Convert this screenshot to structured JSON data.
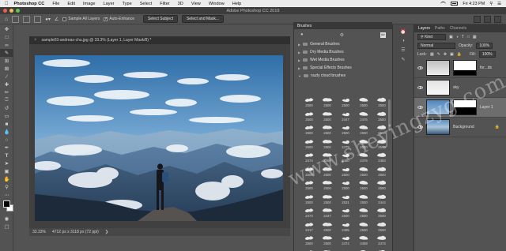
{
  "menubar": {
    "apple_icon": "apple-logo-icon",
    "app_name": "Photoshop CC",
    "items": [
      "File",
      "Edit",
      "Image",
      "Layer",
      "Type",
      "Select",
      "Filter",
      "3D",
      "View",
      "Window",
      "Help"
    ],
    "clock": "Fri 4:23 PM"
  },
  "appbar": {
    "title": "Adobe Photoshop CC 2019"
  },
  "options": {
    "sample_all_layers": "Sample All Layers",
    "auto_enhance": "Auto-Enhance",
    "select_subject": "Select Subject",
    "select_and_mask": "Select and Mask..."
  },
  "document": {
    "tab_title": "sample03-andreas-chu.jpg @ 33.3% (Layer 1, Layer Mask/8) *",
    "zoom": "33.33%",
    "doc_size": "4712 px x 3118 px (72 ppi)"
  },
  "brushes": {
    "panel_title": "Brushes",
    "folders": [
      "General Brushes",
      "Dry Media Brushes",
      "Wet Media Brushes",
      "Special Effects Brushes"
    ],
    "open_folder": "nuzly cloud brushes",
    "sizes": [
      "2500",
      "2500",
      "2500",
      "2500",
      "2500",
      "2500",
      "2500",
      "2447",
      "2476",
      "2500",
      "2500",
      "2500",
      "2500",
      "2500",
      "2500",
      "2500",
      "2500",
      "2479",
      "2500",
      "2500",
      "2474",
      "2469",
      "2480",
      "2476",
      "2483",
      "2500",
      "2500",
      "2500",
      "2500",
      "2500",
      "2500",
      "2500",
      "2500",
      "2500",
      "2500",
      "2500",
      "2500",
      "2531",
      "2500",
      "2444",
      "2474",
      "2447",
      "2500",
      "2500",
      "2500",
      "2417",
      "2500",
      "2485",
      "2500",
      "2500",
      "2500",
      "2500",
      "2474",
      "2458",
      "2474",
      "2500",
      "2500",
      "2500",
      "2500",
      "2500"
    ]
  },
  "layers": {
    "tabs": [
      "Layers",
      "Paths",
      "Channels"
    ],
    "kind": "Kind",
    "blend_mode": "Normal",
    "opacity_label": "Opacity:",
    "opacity": "100%",
    "lock_label": "Lock:",
    "fill_label": "Fill:",
    "fill": "100%",
    "items": [
      {
        "name": "for...ds"
      },
      {
        "name": "sky"
      },
      {
        "name": "Layer 1"
      },
      {
        "name": "Background"
      }
    ]
  },
  "watermark": "www.sheyingzyg.com"
}
